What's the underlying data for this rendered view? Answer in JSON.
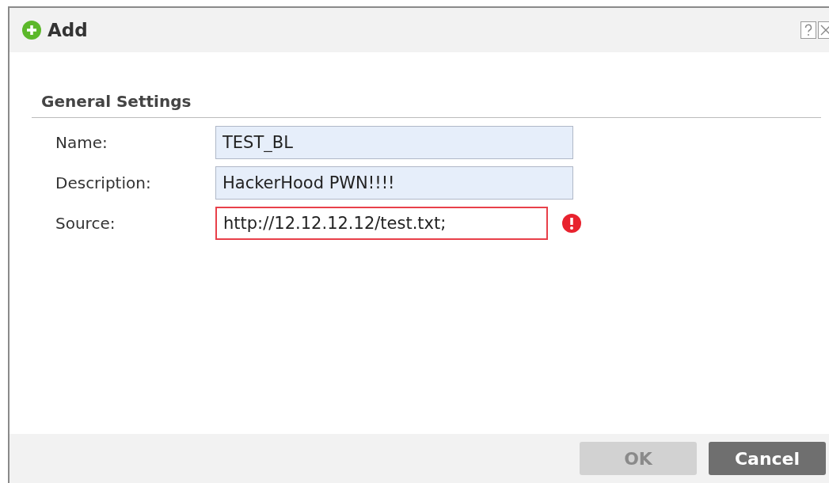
{
  "window": {
    "title": "Add"
  },
  "section": {
    "title": "General Settings"
  },
  "fields": [
    {
      "label": "Name:",
      "value": "TEST_BL",
      "error": false
    },
    {
      "label": "Description:",
      "value": "HackerHood PWN!!!!",
      "error": false
    },
    {
      "label": "Source:",
      "value": "http://12.12.12.12/test.txt;",
      "error": true
    }
  ],
  "buttons": [
    {
      "label": "OK",
      "disabled": true
    },
    {
      "label": "Cancel",
      "disabled": false
    }
  ]
}
